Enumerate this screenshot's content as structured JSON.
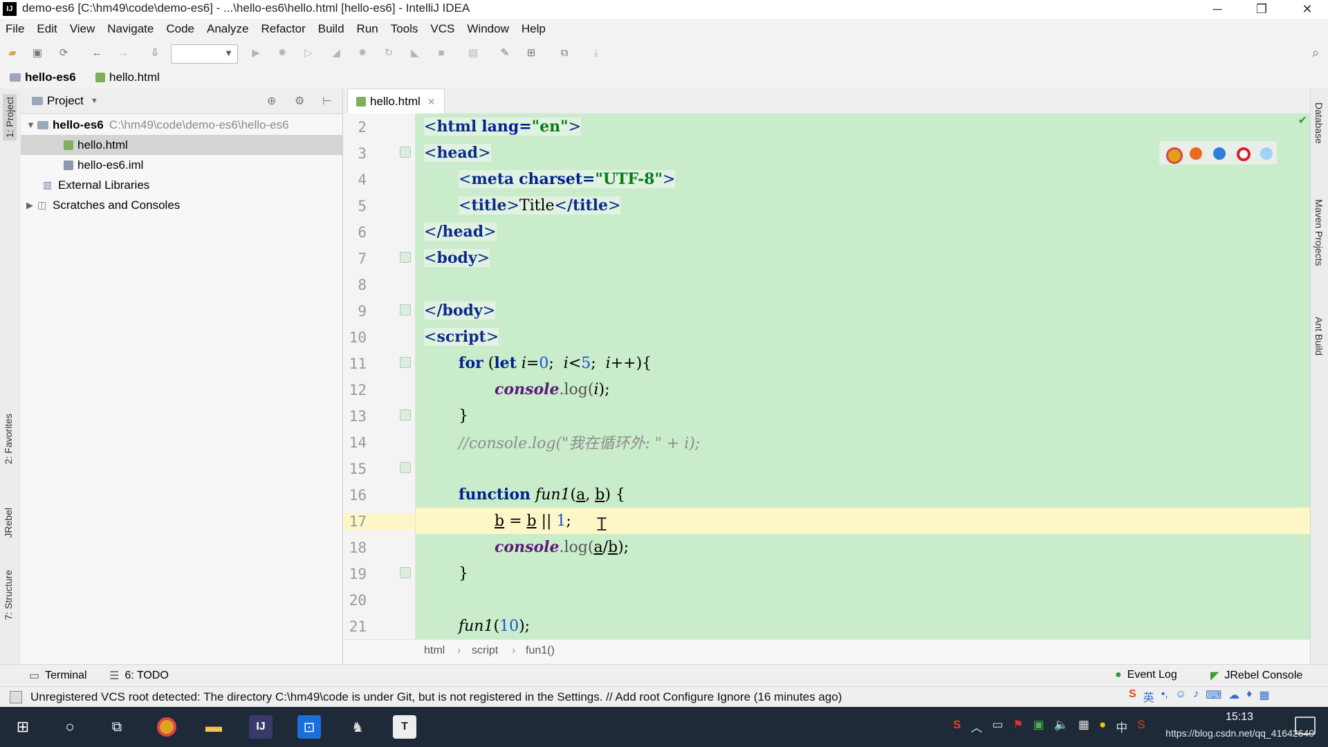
{
  "window": {
    "title": "demo-es6 [C:\\hm49\\code\\demo-es6] - ...\\hello-es6\\hello.html [hello-es6] - IntelliJ IDEA",
    "minimize": "─",
    "restore": "❐",
    "close": "✕"
  },
  "menu": [
    "File",
    "Edit",
    "View",
    "Navigate",
    "Code",
    "Analyze",
    "Refactor",
    "Build",
    "Run",
    "Tools",
    "VCS",
    "Window",
    "Help"
  ],
  "navbar": {
    "project": "hello-es6",
    "file": "hello.html"
  },
  "left_strip": {
    "project_tab": "1: Project",
    "favorites_tab": "2: Favorites",
    "jrebel_tab": "JRebel",
    "structure_tab": "7: Structure"
  },
  "project_panel": {
    "title": "Project",
    "tree": [
      {
        "name": "hello-es6",
        "path": "C:\\hm49\\code\\demo-es6\\hello-es6"
      },
      {
        "name": "hello.html"
      },
      {
        "name": "hello-es6.iml"
      },
      {
        "name": "External Libraries"
      },
      {
        "name": "Scratches and Consoles"
      }
    ]
  },
  "editor": {
    "tab": "hello.html",
    "lines": [
      {
        "n": "2"
      },
      {
        "n": "3"
      },
      {
        "n": "4"
      },
      {
        "n": "5"
      },
      {
        "n": "6"
      },
      {
        "n": "7"
      },
      {
        "n": "8"
      },
      {
        "n": "9"
      },
      {
        "n": "10"
      },
      {
        "n": "11"
      },
      {
        "n": "12"
      },
      {
        "n": "13"
      },
      {
        "n": "14"
      },
      {
        "n": "15"
      },
      {
        "n": "16"
      },
      {
        "n": "17"
      },
      {
        "n": "18"
      },
      {
        "n": "19"
      },
      {
        "n": "20"
      },
      {
        "n": "21"
      }
    ],
    "code": {
      "l2_tag": "html",
      "l2_attr": "lang=",
      "l2_val": "\"en\"",
      "l3_tag": "head",
      "l4_tag": "meta",
      "l4_attr": "charset=",
      "l4_val": "\"UTF-8\"",
      "l5_open": "title",
      "l5_text": "Title",
      "l5_close": "/title",
      "l6_tag": "/head",
      "l7_tag": "body",
      "l9_tag": "/body",
      "l10_tag": "script",
      "l11_for": "for",
      "l11_let": "let",
      "l11_i1": "i",
      "l11_eq0": "=",
      "l11_zero": "0",
      "l11_sc1": ";",
      "l11_i2": "i",
      "l11_lt": "<",
      "l11_five": "5",
      "l11_sc2": ";",
      "l11_i3": "i",
      "l11_pp": "++){",
      "l11_paren": "(",
      "l12_console": "console",
      "l12_dot_log": ".log(",
      "l12_i": "i",
      "l12_end": ");",
      "l13_brace": "}",
      "l14_comment": "//console.log(\"我在循环外: \" + i);",
      "l16_function": "function",
      "l16_name": "fun1",
      "l16_open": "(",
      "l16_a": "a",
      "l16_comma": ", ",
      "l16_b": "b",
      "l16_close": ") {",
      "l17_b1": "b",
      "l17_eq": " = ",
      "l17_b2": "b",
      "l17_or": " || ",
      "l17_one": "1",
      "l17_sc": ";",
      "l18_console": "console",
      "l18_dot_log": ".log(",
      "l18_a": "a",
      "l18_slash": "/",
      "l18_b": "b",
      "l18_end": ");",
      "l19_brace": "}",
      "l21_name": "fun1",
      "l21_open": "(",
      "l21_arg": "10",
      "l21_end": ");"
    },
    "breadcrumb": [
      "html",
      "script",
      "fun1()"
    ]
  },
  "right_strip": {
    "database": "Database",
    "maven": "Maven Projects",
    "ant": "Ant Build"
  },
  "bottom_tools": {
    "terminal": "Terminal",
    "todo": "6: TODO",
    "event_log": "Event Log",
    "jrebel_console": "JRebel Console"
  },
  "status": {
    "message": "Unregistered VCS root detected: The directory C:\\hm49\\code is under Git, but is not registered in the Settings. // Add root  Configure  Ignore (16 minutes ago)"
  },
  "taskbar": {
    "time": "15:13",
    "watermark": "https://blog.csdn.net/qq_41642640"
  },
  "colors": {
    "code_bg": "#c9eccb",
    "current_line": "#fdf7c8",
    "taskbar": "#1f2a38"
  }
}
